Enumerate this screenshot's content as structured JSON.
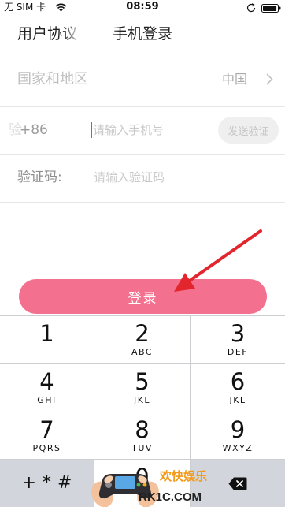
{
  "status_bar": {
    "carrier": "无 SIM 卡",
    "time": "08:59",
    "wifi_icon": "wifi-icon",
    "orientation_icon": "orientation-lock-icon",
    "battery_icon": "battery-icon",
    "battery_level": 0.95
  },
  "header": {
    "agreement_link": "用户协议",
    "title": "手机登录"
  },
  "form": {
    "region": {
      "label": "国家和地区",
      "value": "中国",
      "icon": "chevron-right-icon"
    },
    "phone": {
      "prefix": "+86",
      "placeholder": "请输入手机号",
      "send_code_button": "发送验证"
    },
    "verification_code": {
      "label": "验证码:",
      "placeholder": "请输入验证码"
    }
  },
  "login_button": {
    "label": "登录"
  },
  "keypad": {
    "keys": [
      {
        "digit": "1"
      },
      {
        "digit": "2",
        "letters": "ABC"
      },
      {
        "digit": "3",
        "letters": "DEF"
      },
      {
        "digit": "4",
        "letters": "GHI"
      },
      {
        "digit": "5",
        "letters": "JKL"
      },
      {
        "digit": "6",
        "letters": "JKL"
      },
      {
        "digit": "7",
        "letters": "PQRS"
      },
      {
        "digit": "8",
        "letters": "TUV"
      },
      {
        "digit": "9",
        "letters": "WXYZ"
      }
    ],
    "symbols_key": "+*#",
    "zero_key": "0",
    "delete_icon": "backspace-icon"
  },
  "annotation": {
    "icon": "red-arrow-icon"
  },
  "watermark": {
    "logo_icon": "gamepad-icon",
    "brand_text": "欢快娱乐",
    "site_text": "RK1C.COM",
    "ghost_glyph": "验"
  },
  "colors": {
    "accent": "#f4708f",
    "annotation_arrow": "#e3262e",
    "cursor": "#3b7ff3",
    "watermark_orange": "#f29a1a"
  }
}
